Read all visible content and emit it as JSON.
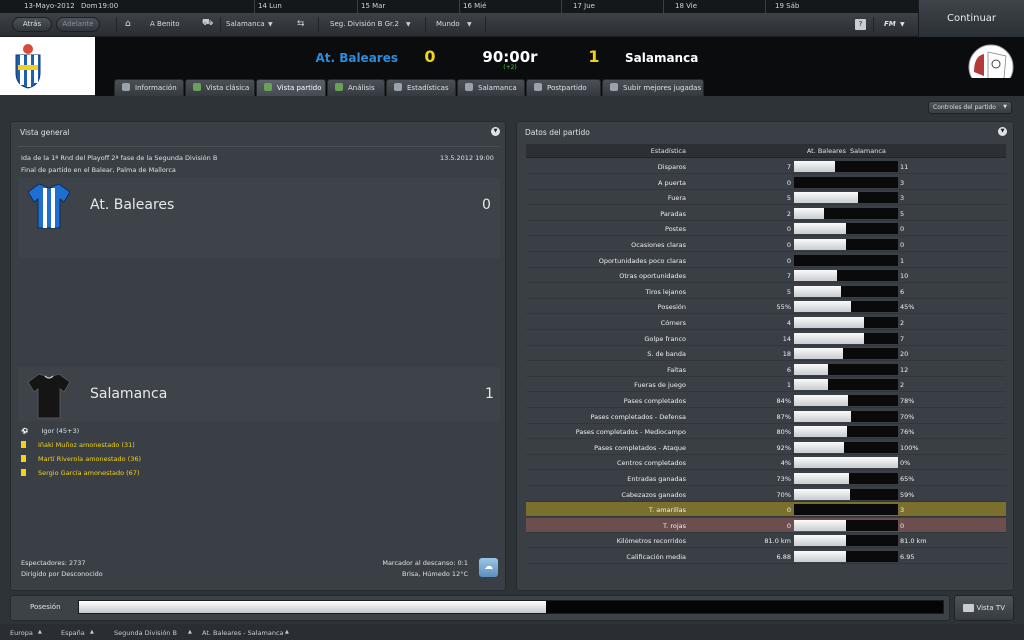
{
  "topbar": {
    "date": "13-Mayo-2012",
    "day": "Dom",
    "time": "19:00",
    "days": [
      "14 Lun",
      "15 Mar",
      "16 Mié",
      "17 Jue",
      "18 Vie",
      "19 Sáb"
    ]
  },
  "nav": {
    "back": "Atrás",
    "forward": "Adelante",
    "manager": "A Benito",
    "club": "Salamanca",
    "competition": "Seg. División B Gr.2",
    "world": "Mundo",
    "help": "?",
    "fm": "FM",
    "continue": "Continuar"
  },
  "match": {
    "home_team": "At. Baleares",
    "home_score": "0",
    "clock": "90:00r",
    "added_time": "(+2)",
    "away_score": "1",
    "away_team": "Salamanca"
  },
  "tabs": [
    "Información",
    "Vista clásica",
    "Vista partido",
    "Análisis",
    "Estadísticas",
    "Salamanca",
    "Postpartido",
    "Subir mejores jugadas"
  ],
  "controls_button": "Controles del partido",
  "overview": {
    "title": "Vista general",
    "competition_line": "Ida de la 1ª Rnd del Playoff 2ª fase de la Segunda División B",
    "datetime": "13.5.2012 19:00",
    "venue_line": "Final de partido en el Balear, Palma de Mallorca",
    "home_team": "At. Baleares",
    "home_score": "0",
    "away_team": "Salamanca",
    "away_score": "1",
    "events": [
      {
        "type": "goal",
        "text": "Igor (45+3)",
        "color": "#dfe3e6"
      },
      {
        "type": "yellow",
        "text": "Iñaki Muñoz amonestado (31)",
        "color": "#f2d21a"
      },
      {
        "type": "yellow",
        "text": "Martí Riverola amonestado (36)",
        "color": "#f2d21a"
      },
      {
        "type": "yellow",
        "text": "Sergio García amonestado (67)",
        "color": "#f2d21a"
      }
    ],
    "spectators": "Espectadores: 2737",
    "referee": "Dirigido por Desconocido",
    "halftime": "Marcador al descanso: 0:1",
    "weather": "Brisa, Húmedo 12°C"
  },
  "stats": {
    "title": "Datos del partido",
    "header_label": "Estadística",
    "header_home": "At. Baleares",
    "header_away": "Salamanca",
    "rows": [
      {
        "label": "Disparos",
        "home": "7",
        "away": "11",
        "share": 0.39
      },
      {
        "label": "A puerta",
        "home": "0",
        "away": "3",
        "share": 0.0
      },
      {
        "label": "Fuera",
        "home": "5",
        "away": "3",
        "share": 0.62
      },
      {
        "label": "Paradas",
        "home": "2",
        "away": "5",
        "share": 0.29
      },
      {
        "label": "Postes",
        "home": "0",
        "away": "0",
        "share": 0.5
      },
      {
        "label": "Ocasiones claras",
        "home": "0",
        "away": "0",
        "share": 0.5
      },
      {
        "label": "Oportunidades poco claras",
        "home": "0",
        "away": "1",
        "share": 0.0
      },
      {
        "label": "Otras oportunidades",
        "home": "7",
        "away": "10",
        "share": 0.41
      },
      {
        "label": "Tiros lejanos",
        "home": "5",
        "away": "6",
        "share": 0.45
      },
      {
        "label": "Posesión",
        "home": "55%",
        "away": "45%",
        "share": 0.55
      },
      {
        "label": "Córners",
        "home": "4",
        "away": "2",
        "share": 0.67
      },
      {
        "label": "Golpe franco",
        "home": "14",
        "away": "7",
        "share": 0.67
      },
      {
        "label": "S. de banda",
        "home": "18",
        "away": "20",
        "share": 0.47
      },
      {
        "label": "Faltas",
        "home": "6",
        "away": "12",
        "share": 0.33
      },
      {
        "label": "Fueras de juego",
        "home": "1",
        "away": "2",
        "share": 0.33
      },
      {
        "label": "Pases completados",
        "home": "84%",
        "away": "78%",
        "share": 0.52
      },
      {
        "label": "Pases completados - Defensa",
        "home": "87%",
        "away": "70%",
        "share": 0.55
      },
      {
        "label": "Pases completados - Mediocampo",
        "home": "80%",
        "away": "76%",
        "share": 0.51
      },
      {
        "label": "Pases completados - Ataque",
        "home": "92%",
        "away": "100%",
        "share": 0.48
      },
      {
        "label": "Centros completados",
        "home": "4%",
        "away": "0%",
        "share": 1.0
      },
      {
        "label": "Entradas ganadas",
        "home": "73%",
        "away": "65%",
        "share": 0.53
      },
      {
        "label": "Cabezazos ganados",
        "home": "70%",
        "away": "59%",
        "share": 0.54
      },
      {
        "label": "T. amarillas",
        "home": "0",
        "away": "3",
        "share": 0.0,
        "highlight": "yel"
      },
      {
        "label": "T. rojas",
        "home": "0",
        "away": "0",
        "share": 0.5,
        "highlight": "red"
      },
      {
        "label": "Kilómetros recorridos",
        "home": "81.0 km",
        "away": "81.0 km",
        "share": 0.5
      },
      {
        "label": "Calificación media",
        "home": "6.88",
        "away": "6.95",
        "share": 0.5
      }
    ]
  },
  "possession": {
    "label": "Posesión",
    "home_share": 0.54
  },
  "tv_button": "Vista TV",
  "breadcrumbs": [
    "Europa",
    "España",
    "Segunda División B",
    "At. Baleares - Salamanca"
  ],
  "colors": {
    "home_accent": "#2e8cd9",
    "score_yellow": "#f2d21a",
    "added_time_green": "#4ec34e"
  }
}
